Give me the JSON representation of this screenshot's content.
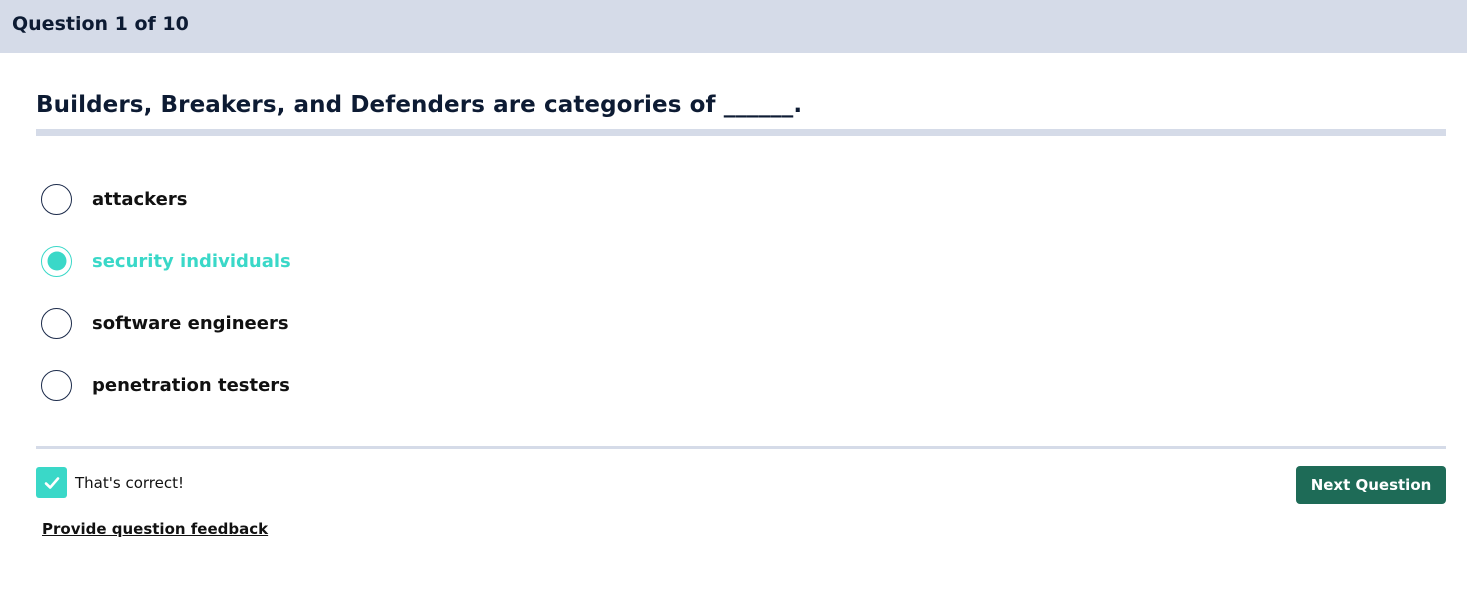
{
  "header": {
    "title": "Question 1 of 10"
  },
  "question": {
    "text": "Builders, Breakers, and Defenders are categories of ______."
  },
  "options": [
    {
      "label": "attackers",
      "selected": false
    },
    {
      "label": "security individuals",
      "selected": true
    },
    {
      "label": "software engineers",
      "selected": false
    },
    {
      "label": "penetration testers",
      "selected": false
    }
  ],
  "result": {
    "icon": "check-icon",
    "text": "That's correct!"
  },
  "footer": {
    "feedback_link": "Provide question feedback",
    "next_button": "Next Question"
  },
  "colors": {
    "header_bg": "#d5dbe8",
    "accent": "#3ad8c8",
    "button_bg": "#1e6b57",
    "text": "#0d1b33"
  }
}
